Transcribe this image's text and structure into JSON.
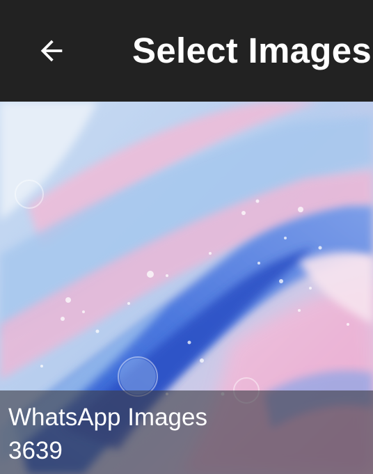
{
  "app_bar": {
    "back_icon": "arrow-left-icon",
    "title": "Select Images",
    "background": "#222222"
  },
  "albums": [
    {
      "name": "WhatsApp Images",
      "count": "3639",
      "thumbnail": "abstract-fluid-paint-image",
      "colors": [
        "#3f6fd8",
        "#a9c9ef",
        "#f0b8d6",
        "#e8e6f2"
      ]
    }
  ]
}
